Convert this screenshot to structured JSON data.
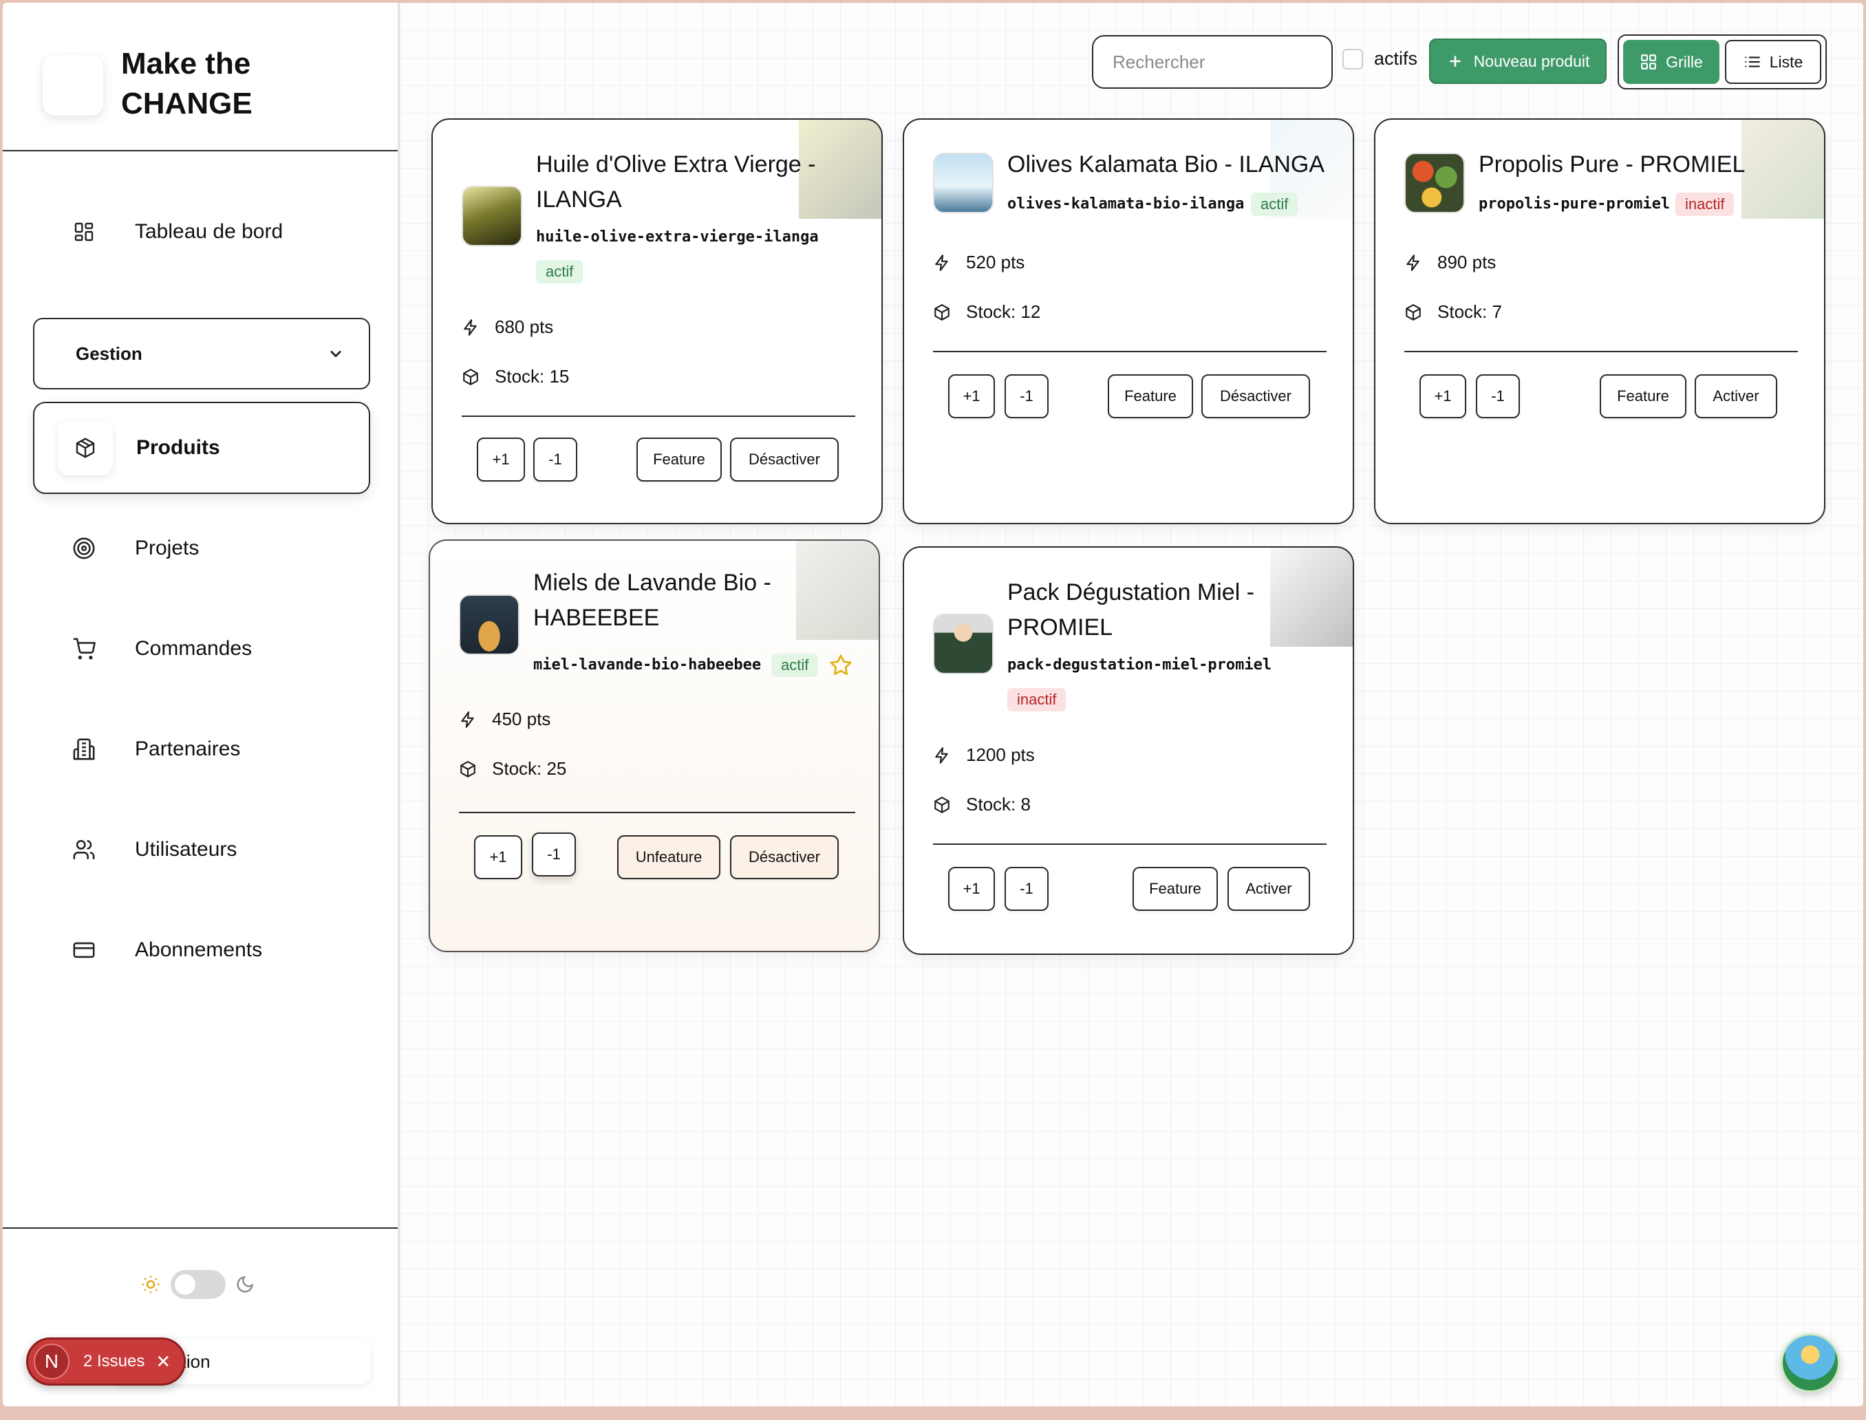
{
  "brand": {
    "title_line1": "Make the",
    "title_line2": "CHANGE"
  },
  "nav": {
    "dashboard": "Tableau de bord",
    "section": "Gestion",
    "items": [
      {
        "label": "Produits",
        "icon": "box-icon",
        "active": true
      },
      {
        "label": "Projets",
        "icon": "target-icon"
      },
      {
        "label": "Commandes",
        "icon": "cart-icon"
      },
      {
        "label": "Partenaires",
        "icon": "building-icon"
      },
      {
        "label": "Utilisateurs",
        "icon": "users-icon"
      },
      {
        "label": "Abonnements",
        "icon": "credit-card-icon"
      }
    ]
  },
  "footer": {
    "logout_label": "onnexion",
    "issues_label": "2 Issues",
    "issues_badge": "N"
  },
  "toolbar": {
    "search_placeholder": "Rechercher",
    "active_filter_label": "actifs",
    "new_product_label": "Nouveau produit",
    "grid_label": "Grille",
    "list_label": "Liste"
  },
  "colors": {
    "accent": "#3f9a6a",
    "active_badge_bg": "#e3f6e6",
    "inactive_badge_bg": "#fbe1e1",
    "featured_star": "#e3b21b"
  },
  "products": [
    {
      "title_l1": "Huile d'Olive Extra Vierge -",
      "title_l2": "ILANGA",
      "slug": "huile-olive-extra-vierge-ilanga",
      "status": "actif",
      "points": "680 pts",
      "stock": "Stock: 15",
      "plus": "+1",
      "minus": "-1",
      "feature": "Feature",
      "toggle": "Désactiver"
    },
    {
      "title_l1": "Olives Kalamata Bio - ILANGA",
      "slug": "olives-kalamata-bio-ilanga",
      "status": "actif",
      "points": "520 pts",
      "stock": "Stock: 12",
      "plus": "+1",
      "minus": "-1",
      "feature": "Feature",
      "toggle": "Désactiver"
    },
    {
      "title_l1": "Propolis Pure - PROMIEL",
      "slug": "propolis-pure-promiel",
      "status": "inactif",
      "points": "890 pts",
      "stock": "Stock: 7",
      "plus": "+1",
      "minus": "-1",
      "feature": "Feature",
      "toggle": "Activer"
    },
    {
      "title_l1": "Miels de Lavande Bio -",
      "title_l2": "HABEEBEE",
      "slug": "miel-lavande-bio-habeebee",
      "status": "actif",
      "points": "450 pts",
      "stock": "Stock: 25",
      "plus": "+1",
      "minus": "-1",
      "feature": "Unfeature",
      "toggle": "Désactiver",
      "featured": true
    },
    {
      "title_l1": "Pack Dégustation Miel -",
      "title_l2": "PROMIEL",
      "slug": "pack-degustation-miel-promiel",
      "status": "inactif",
      "points": "1200 pts",
      "stock": "Stock: 8",
      "plus": "+1",
      "minus": "-1",
      "feature": "Feature",
      "toggle": "Activer"
    }
  ]
}
